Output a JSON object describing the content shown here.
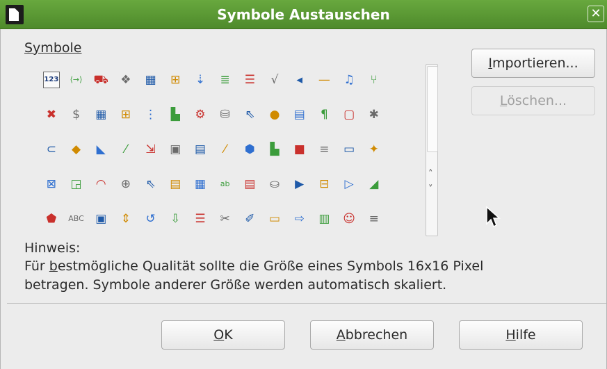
{
  "window": {
    "title": "Symbole Austauschen"
  },
  "symbols_label": "Symbole",
  "symbols": [
    "123",
    "⟨→⟩",
    "⛟",
    "❖",
    "▦",
    "⊞",
    "⇣",
    "≣",
    "☰",
    "√",
    "◂",
    "—",
    "♫",
    "⑂",
    "✖",
    "$",
    "▦",
    "⊞",
    "⋮",
    "▙",
    "⚙",
    "⛁",
    "⇖",
    "●",
    "▤",
    "¶",
    "▢",
    "✱",
    "⊂",
    "◆",
    "◣",
    "⁄",
    "⇲",
    "▣",
    "▤",
    "⁄",
    "⬢",
    "▙",
    "■",
    "≡",
    "▭",
    "✦",
    "⊠",
    "◲",
    "◠",
    "⊕",
    "⇖",
    "▤",
    "▦",
    "ab",
    "▤",
    "⛀",
    "▶",
    "⊟",
    "▷",
    "◢",
    "⬟",
    "ABC",
    "▣",
    "⇕",
    "↺",
    "⇩",
    "☰",
    "✂",
    "✐",
    "▭",
    "⇨",
    "▥",
    "☺",
    "≡"
  ],
  "buttons": {
    "import_pre": "I",
    "import_rest": "mportieren...",
    "delete_pre": "L",
    "delete_rest": "öschen...",
    "ok_pre": "O",
    "ok_rest": "K",
    "cancel_pre": "A",
    "cancel_rest": "bbrechen",
    "help_pre": "H",
    "help_rest": "ilfe"
  },
  "hint": {
    "title": "Hinweis:",
    "line1_pre": "Für ",
    "line1_link": "b",
    "line1_rest": "estmögliche Qualität sollte die Größe eines Symbols 16x16 Pixel",
    "line2": "betragen. Symbole anderer Größe werden automatisch skaliert."
  },
  "colors": {
    "titlebar": "#5a9a33",
    "accent_icons": "#2f6fd0"
  }
}
